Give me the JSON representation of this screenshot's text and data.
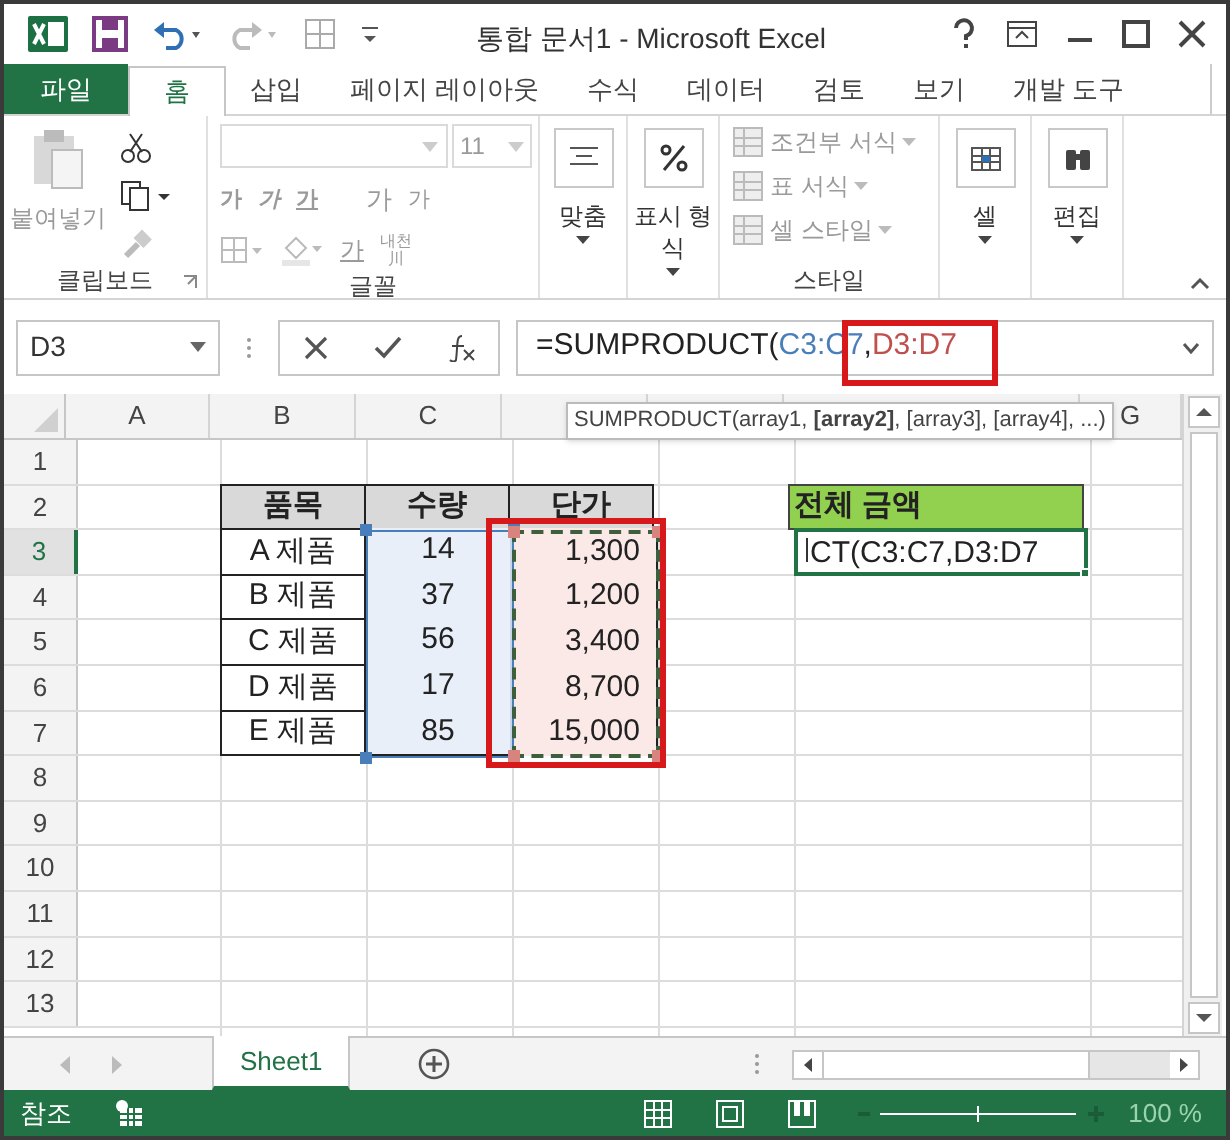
{
  "window": {
    "title": "통합 문서1 - Microsoft Excel"
  },
  "tabs": [
    {
      "label": "파일",
      "kind": "file",
      "selected": false
    },
    {
      "label": "홈",
      "kind": "tab",
      "selected": true
    },
    {
      "label": "삽입",
      "kind": "tab",
      "selected": false
    },
    {
      "label": "페이지 레이아웃",
      "kind": "tab",
      "selected": false
    },
    {
      "label": "수식",
      "kind": "tab",
      "selected": false
    },
    {
      "label": "데이터",
      "kind": "tab",
      "selected": false
    },
    {
      "label": "검토",
      "kind": "tab",
      "selected": false
    },
    {
      "label": "보기",
      "kind": "tab",
      "selected": false
    },
    {
      "label": "개발 도구",
      "kind": "tab",
      "selected": false
    }
  ],
  "ribbon": {
    "clipboard": {
      "label": "클립보드",
      "paste": "붙여넣기",
      "disabled": true
    },
    "font": {
      "label": "글꼴",
      "size": "11",
      "bold": "가",
      "italic": "가",
      "underline": "가",
      "grow": "가",
      "shrink": "가",
      "font_color": "가",
      "phonetic_top": "내천",
      "phonetic_bottom": "川",
      "disabled": true
    },
    "alignment": {
      "label": "맞춤"
    },
    "number": {
      "label": "표시 형식"
    },
    "styles": {
      "label": "스타일",
      "items": [
        {
          "label": "조건부 서식",
          "disabled": true
        },
        {
          "label": "표 서식",
          "disabled": true
        },
        {
          "label": "셀 스타일",
          "disabled": true
        }
      ]
    },
    "cells": {
      "label": "셀"
    },
    "editing": {
      "label": "편집"
    }
  },
  "name_box": {
    "value": "D3"
  },
  "formula": [
    {
      "text": "=SUMPRODUCT(",
      "kind": "plain"
    },
    {
      "text": "C3:C7",
      "kind": "ref",
      "color": "#4a7ebb"
    },
    {
      "text": ",",
      "kind": "plain"
    },
    {
      "text": "D3:D7",
      "kind": "ref",
      "color": "#c0504d"
    }
  ],
  "tooltip": "SUMPRODUCT(array1, **[array2]**, [array3], [array4], ...)",
  "columns": [
    {
      "label": "A"
    },
    {
      "label": "B"
    },
    {
      "label": "C"
    },
    {},
    {},
    {},
    {
      "label": "G"
    }
  ],
  "rows": [
    {
      "number": "1",
      "selected": false,
      "cells": [
        null,
        null,
        null,
        null,
        null,
        null,
        null
      ]
    },
    {
      "number": "2",
      "selected": false,
      "cells": [
        null,
        {
          "text": "품목",
          "kind": "header"
        },
        {
          "text": "수량",
          "kind": "header"
        },
        {
          "text": "단가",
          "kind": "header"
        },
        null,
        {
          "text": "전체 금액",
          "kind": "total_label"
        },
        null
      ]
    },
    {
      "number": "3",
      "selected": true,
      "cells": [
        null,
        {
          "text": "A 제품",
          "kind": "item"
        },
        {
          "text": "14",
          "kind": "ref_blue"
        },
        {
          "text": "1,300",
          "kind": "ref_red"
        },
        null,
        {
          "text": "CT(C3:C7,D3:D7",
          "kind": "editing"
        },
        null
      ]
    },
    {
      "number": "4",
      "selected": false,
      "cells": [
        null,
        {
          "text": "B 제품",
          "kind": "item"
        },
        {
          "text": "37",
          "kind": "ref_blue"
        },
        {
          "text": "1,200",
          "kind": "ref_red"
        },
        null,
        null,
        null
      ]
    },
    {
      "number": "5",
      "selected": false,
      "cells": [
        null,
        {
          "text": "C 제품",
          "kind": "item"
        },
        {
          "text": "56",
          "kind": "ref_blue"
        },
        {
          "text": "3,400",
          "kind": "ref_red"
        },
        null,
        null,
        null
      ]
    },
    {
      "number": "6",
      "selected": false,
      "cells": [
        null,
        {
          "text": "D 제품",
          "kind": "item"
        },
        {
          "text": "17",
          "kind": "ref_blue"
        },
        {
          "text": "8,700",
          "kind": "ref_red"
        },
        null,
        null,
        null
      ]
    },
    {
      "number": "7",
      "selected": false,
      "cells": [
        null,
        {
          "text": "E 제품",
          "kind": "item"
        },
        {
          "text": "85",
          "kind": "ref_blue"
        },
        {
          "text": "15,000",
          "kind": "ref_red"
        },
        null,
        null,
        null
      ]
    },
    {
      "number": "8",
      "selected": false,
      "cells": [
        null,
        null,
        null,
        null,
        null,
        null,
        null
      ]
    },
    {
      "number": "9",
      "selected": false,
      "cells": [
        null,
        null,
        null,
        null,
        null,
        null,
        null
      ]
    },
    {
      "number": "10",
      "selected": false,
      "cells": [
        null,
        null,
        null,
        null,
        null,
        null,
        null
      ]
    },
    {
      "number": "11",
      "selected": false,
      "cells": [
        null,
        null,
        null,
        null,
        null,
        null,
        null
      ]
    },
    {
      "number": "12",
      "selected": false,
      "cells": [
        null,
        null,
        null,
        null,
        null,
        null,
        null
      ]
    },
    {
      "number": "13",
      "selected": false,
      "cells": [
        null,
        null,
        null,
        null,
        null,
        null,
        null
      ]
    }
  ],
  "sheet_tabs": [
    {
      "label": "Sheet1",
      "selected": true
    }
  ],
  "status_bar": {
    "mode": "참조",
    "zoom": "100 %"
  }
}
